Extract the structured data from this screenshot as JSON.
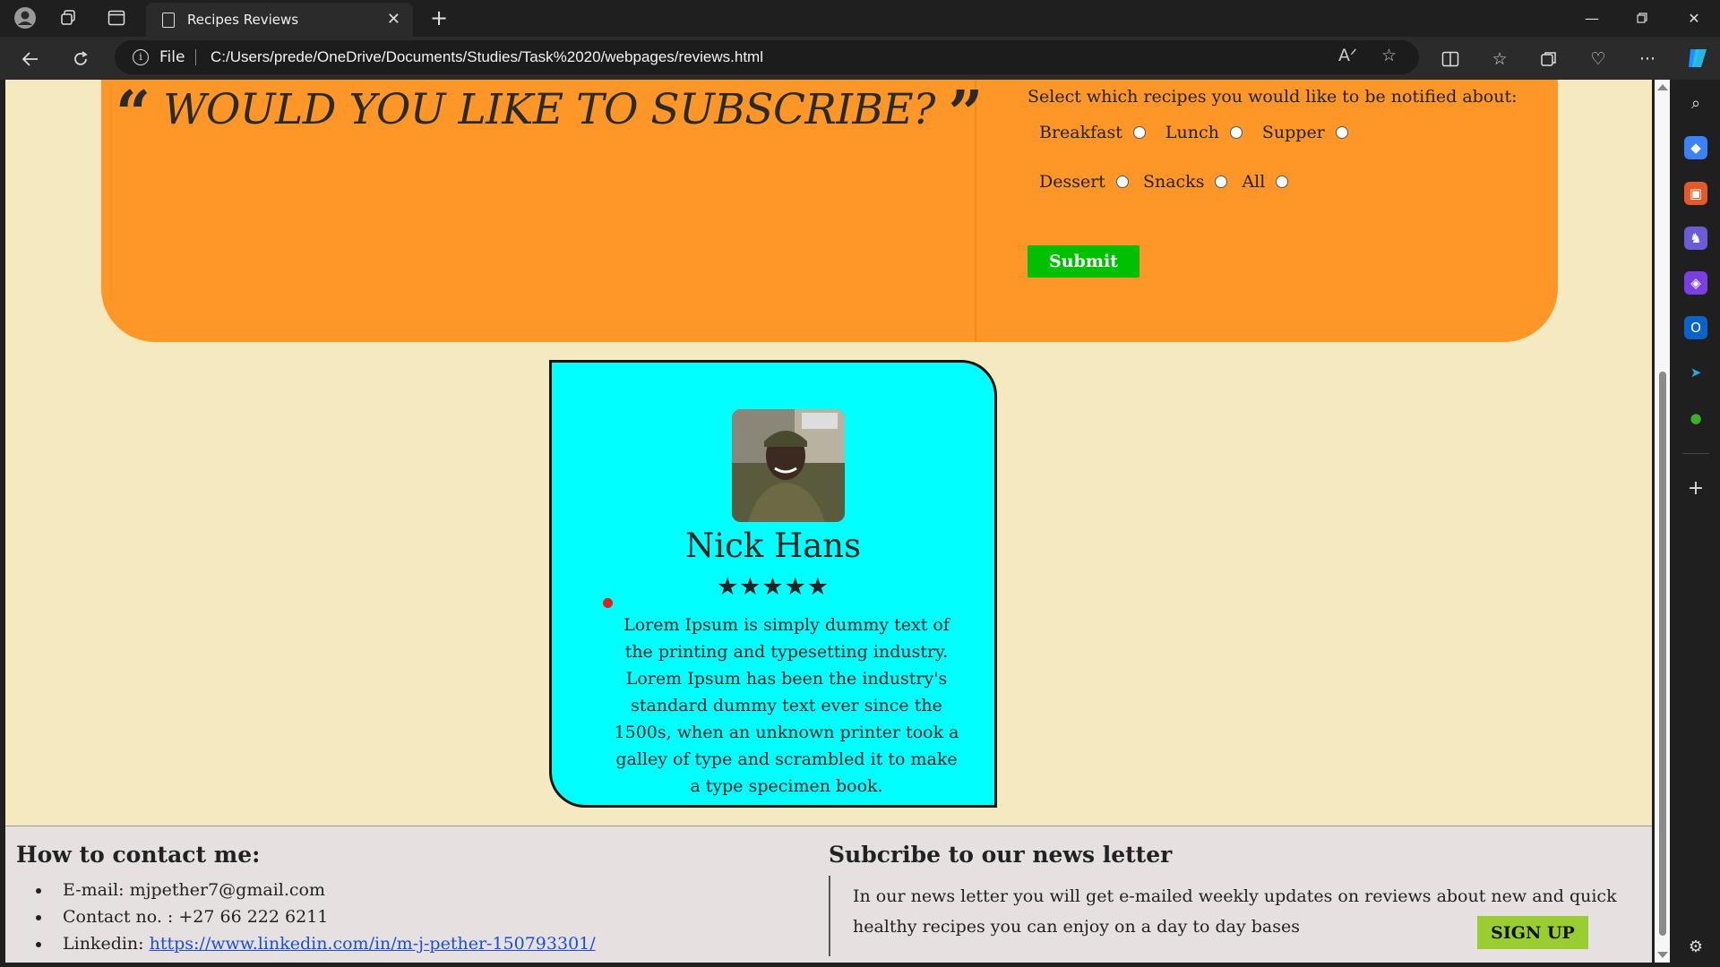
{
  "browser": {
    "tab_title": "Recipes Reviews",
    "address_scheme": "File",
    "url": "C:/Users/prede/OneDrive/Documents/Studies/Task%2020/webpages/reviews.html"
  },
  "subscribe": {
    "title": "WOULD YOU LIKE TO SUBSCRIBE?",
    "open_quote": "“",
    "close_quote": "”",
    "prompt": "Select which recipes you would like to be notified about:",
    "options_row1": [
      "Breakfast",
      "Lunch",
      "Supper"
    ],
    "options_row2": [
      "Dessert",
      "Snacks",
      "All"
    ],
    "submit_label": "Submit"
  },
  "review": {
    "name": "Nick Hans",
    "rating": 5,
    "stars": "★★★★★",
    "text": "Lorem Ipsum is simply dummy text of the printing and typesetting industry. Lorem Ipsum has been the industry's standard dummy text ever since the 1500s, when an unknown printer took a galley of type and scrambled it to make a type specimen book."
  },
  "footer": {
    "contact_heading": "How to contact me:",
    "contact": {
      "email": "E-mail: mjpether7@gmail.com",
      "phone": "Contact no. : +27 66 222 6211",
      "linkedin_label": "Linkedin: ",
      "linkedin_url": "https://www.linkedin.com/in/m-j-pether-150793301/"
    },
    "newsletter_heading": "Subcribe to our news letter",
    "newsletter_text": "In our news letter you will get e-mailed weekly updates on reviews about new and quick healthy recipes you can enjoy on a day to day bases",
    "signup_label": "SIGN UP"
  },
  "colors": {
    "page_bg": "#f5e9bf",
    "subscribe_bg": "#ff9628",
    "card_bg": "#00ffff",
    "submit_bg": "#00c000",
    "signup_bg": "#9acd32",
    "footer_bg": "#e6e1e0"
  }
}
